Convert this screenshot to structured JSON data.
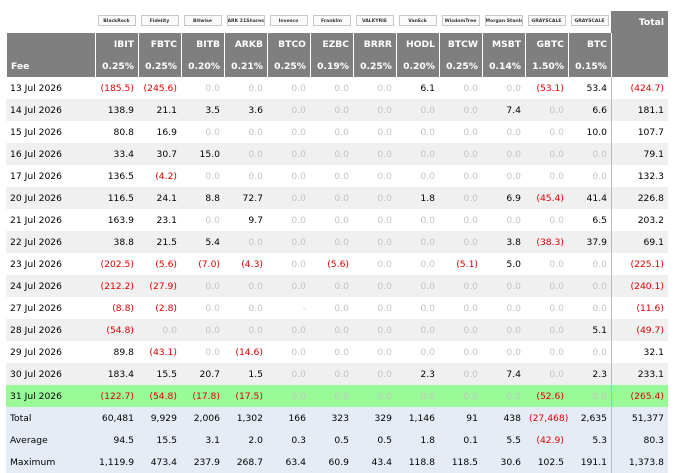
{
  "header": {
    "total_label": "Total",
    "fee_label": "Fee",
    "issuers": [
      "BlackRock",
      "Fidelity",
      "Bitwise",
      "ARK 21Shares",
      "Invesco",
      "Franklin",
      "VALKYRIE",
      "VanEck",
      "WisdomTree",
      "Morgan Stanley",
      "GRAYSCALE",
      "GRAYSCALE"
    ],
    "tickers": [
      "IBIT",
      "FBTC",
      "BITB",
      "ARKB",
      "BTCO",
      "EZBC",
      "BRRR",
      "HODL",
      "BTCW",
      "MSBT",
      "GBTC",
      "BTC"
    ],
    "fees": [
      "0.25%",
      "0.25%",
      "0.20%",
      "0.21%",
      "0.25%",
      "0.19%",
      "0.25%",
      "0.20%",
      "0.25%",
      "0.14%",
      "1.50%",
      "0.15%"
    ]
  },
  "rows": [
    {
      "date": "13 Jul 2026",
      "values": [
        "(185.5)",
        "(245.6)",
        "0.0",
        "0.0",
        "0.0",
        "0.0",
        "0.0",
        "6.1",
        "0.0",
        "0.0",
        "(53.1)",
        "53.4"
      ],
      "total": "(424.7)"
    },
    {
      "date": "14 Jul 2026",
      "values": [
        "138.9",
        "21.1",
        "3.5",
        "3.6",
        "0.0",
        "0.0",
        "0.0",
        "0.0",
        "0.0",
        "7.4",
        "0.0",
        "6.6"
      ],
      "total": "181.1"
    },
    {
      "date": "15 Jul 2026",
      "values": [
        "80.8",
        "16.9",
        "0.0",
        "0.0",
        "0.0",
        "0.0",
        "0.0",
        "0.0",
        "0.0",
        "0.0",
        "0.0",
        "10.0"
      ],
      "total": "107.7"
    },
    {
      "date": "16 Jul 2026",
      "values": [
        "33.4",
        "30.7",
        "15.0",
        "0.0",
        "0.0",
        "0.0",
        "0.0",
        "0.0",
        "0.0",
        "0.0",
        "0.0",
        "0.0"
      ],
      "total": "79.1"
    },
    {
      "date": "17 Jul 2026",
      "values": [
        "136.5",
        "(4.2)",
        "0.0",
        "0.0",
        "0.0",
        "0.0",
        "0.0",
        "0.0",
        "0.0",
        "0.0",
        "0.0",
        "0.0"
      ],
      "total": "132.3"
    },
    {
      "date": "20 Jul 2026",
      "values": [
        "116.5",
        "24.1",
        "8.8",
        "72.7",
        "0.0",
        "0.0",
        "0.0",
        "1.8",
        "0.0",
        "6.9",
        "(45.4)",
        "41.4"
      ],
      "total": "226.8"
    },
    {
      "date": "21 Jul 2026",
      "values": [
        "163.9",
        "23.1",
        "0.0",
        "9.7",
        "0.0",
        "0.0",
        "0.0",
        "0.0",
        "0.0",
        "0.0",
        "0.0",
        "6.5"
      ],
      "total": "203.2"
    },
    {
      "date": "22 Jul 2026",
      "values": [
        "38.8",
        "21.5",
        "5.4",
        "0.0",
        "0.0",
        "0.0",
        "0.0",
        "0.0",
        "0.0",
        "3.8",
        "(38.3)",
        "37.9"
      ],
      "total": "69.1"
    },
    {
      "date": "23 Jul 2026",
      "values": [
        "(202.5)",
        "(5.6)",
        "(7.0)",
        "(4.3)",
        "0.0",
        "(5.6)",
        "0.0",
        "0.0",
        "(5.1)",
        "5.0",
        "0.0",
        "0.0"
      ],
      "total": "(225.1)"
    },
    {
      "date": "24 Jul 2026",
      "values": [
        "(212.2)",
        "(27.9)",
        "0.0",
        "0.0",
        "0.0",
        "0.0",
        "0.0",
        "0.0",
        "0.0",
        "0.0",
        "0.0",
        "0.0"
      ],
      "total": "(240.1)"
    },
    {
      "date": "27 Jul 2026",
      "values": [
        "(8.8)",
        "(2.8)",
        "0.0",
        "0.0",
        "-",
        "0.0",
        "0.0",
        "0.0",
        "0.0",
        "0.0",
        "0.0",
        "0.0"
      ],
      "total": "(11.6)"
    },
    {
      "date": "28 Jul 2026",
      "values": [
        "(54.8)",
        "0.0",
        "0.0",
        "0.0",
        "0.0",
        "0.0",
        "0.0",
        "0.0",
        "0.0",
        "0.0",
        "0.0",
        "5.1"
      ],
      "total": "(49.7)"
    },
    {
      "date": "29 Jul 2026",
      "values": [
        "89.8",
        "(43.1)",
        "0.0",
        "(14.6)",
        "0.0",
        "0.0",
        "0.0",
        "0.0",
        "0.0",
        "0.0",
        "0.0",
        "0.0"
      ],
      "total": "32.1"
    },
    {
      "date": "30 Jul 2026",
      "values": [
        "183.4",
        "15.5",
        "20.7",
        "1.5",
        "0.0",
        "0.0",
        "0.0",
        "2.3",
        "0.0",
        "7.4",
        "0.0",
        "2.3"
      ],
      "total": "233.1"
    },
    {
      "date": "31 Jul 2026",
      "values": [
        "(122.7)",
        "(54.8)",
        "(17.8)",
        "(17.5)",
        "0.0",
        "0.0",
        "0.0",
        "0.0",
        "0.0",
        "0.0",
        "(52.6)",
        "0.0"
      ],
      "total": "(265.4)",
      "highlight": true
    }
  ],
  "summary": [
    {
      "label": "Total",
      "values": [
        "60,481",
        "9,929",
        "2,006",
        "1,302",
        "166",
        "323",
        "329",
        "1,146",
        "91",
        "438",
        "(27,468)",
        "2,635"
      ],
      "total": "51,377"
    },
    {
      "label": "Average",
      "values": [
        "94.5",
        "15.5",
        "3.1",
        "2.0",
        "0.3",
        "0.5",
        "0.5",
        "1.8",
        "0.1",
        "5.5",
        "(42.9)",
        "5.3"
      ],
      "total": "80.3"
    },
    {
      "label": "Maximum",
      "values": [
        "1,119.9",
        "473.4",
        "237.9",
        "268.7",
        "63.4",
        "60.9",
        "43.4",
        "118.8",
        "118.5",
        "30.6",
        "102.5",
        "191.1"
      ],
      "total": "1,373.8"
    }
  ],
  "colors": {
    "header_bg": "#7f7f7f",
    "negative": "#e00000",
    "zero": "#c4c4c4",
    "highlight": "#98fb98",
    "summary_bg": "#e6ecf5",
    "alt_row": "#f0f0f0"
  }
}
